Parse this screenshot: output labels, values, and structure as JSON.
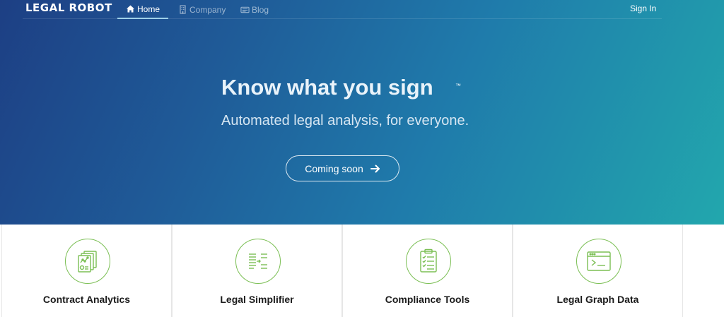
{
  "header": {
    "brand": "LEGAL ROBOT",
    "nav": [
      {
        "label": "Home",
        "icon": "home-icon",
        "active": true
      },
      {
        "label": "Company",
        "icon": "building-icon",
        "active": false
      },
      {
        "label": "Blog",
        "icon": "newspaper-icon",
        "active": false
      }
    ],
    "sign_in": "Sign In"
  },
  "hero": {
    "title": "Know what you sign",
    "trademark": "™",
    "subtitle": "Automated legal analysis, for everyone.",
    "cta_label": "Coming soon",
    "cta_icon": "arrow-right-icon"
  },
  "features": [
    {
      "label": "Contract Analytics",
      "icon": "contract-analytics-icon"
    },
    {
      "label": "Legal Simplifier",
      "icon": "simplifier-icon"
    },
    {
      "label": "Compliance Tools",
      "icon": "clipboard-checklist-icon"
    },
    {
      "label": "Legal Graph Data",
      "icon": "terminal-window-icon"
    }
  ],
  "colors": {
    "hero_gradient_start": "#1d3f84",
    "hero_gradient_end": "#22a7ad",
    "accent_green": "#7bbf54",
    "feature_text": "#1b1b1b"
  }
}
